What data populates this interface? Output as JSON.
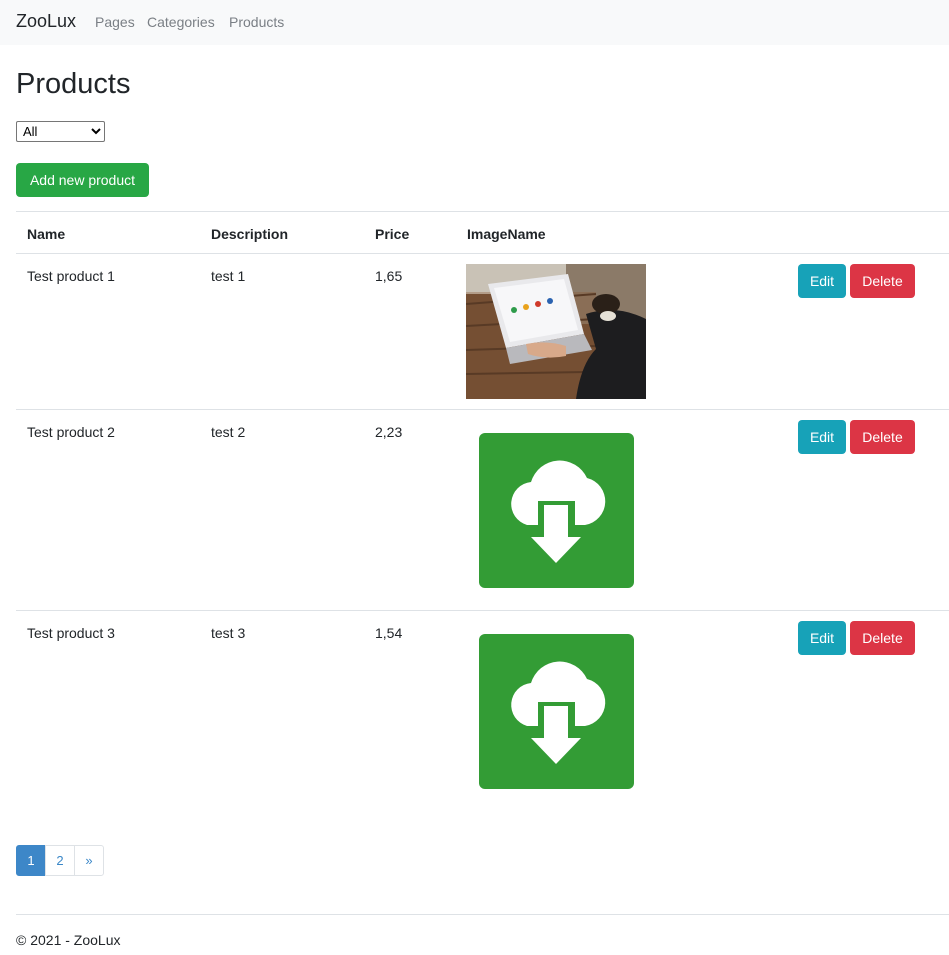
{
  "navbar": {
    "brand": "ZooLux",
    "links": [
      "Pages",
      "Categories",
      "Products"
    ]
  },
  "page": {
    "title": "Products",
    "filter_value": "All",
    "filter_options": [
      "All"
    ],
    "add_button": "Add new product"
  },
  "table": {
    "headers": [
      "Name",
      "Description",
      "Price",
      "ImageName",
      ""
    ],
    "rows": [
      {
        "name": "Test product 1",
        "description": "test 1",
        "price": "1,65",
        "image": "laptop-photo"
      },
      {
        "name": "Test product 2",
        "description": "test 2",
        "price": "2,23",
        "image": "cloud-download-icon"
      },
      {
        "name": "Test product 3",
        "description": "test 3",
        "price": "1,54",
        "image": "cloud-download-icon"
      }
    ],
    "edit_label": "Edit",
    "delete_label": "Delete"
  },
  "pagination": {
    "pages": [
      "1",
      "2"
    ],
    "next": "»",
    "active_page": "1"
  },
  "footer": {
    "text": "© 2021 - ZooLux"
  },
  "colors": {
    "success": "#28a745",
    "info": "#17a2b8",
    "danger": "#dc3545",
    "icon_green": "#339c35"
  }
}
